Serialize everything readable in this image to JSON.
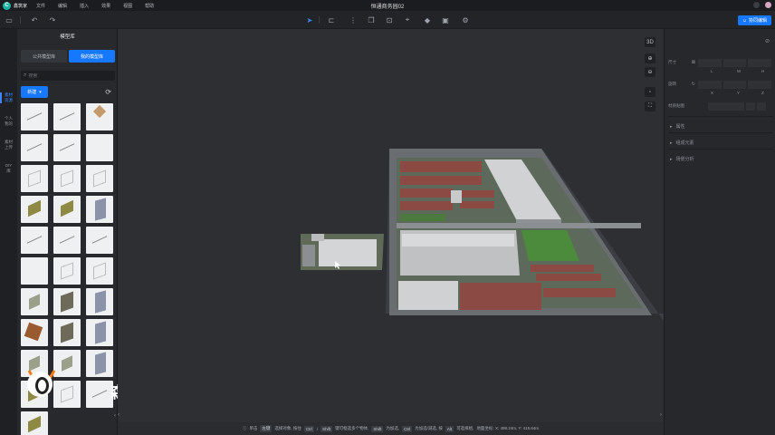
{
  "app": {
    "brand": "鑫筑家",
    "project_title": "恒通商务园02",
    "menus": [
      "文件",
      "编辑",
      "插入",
      "效果",
      "视图",
      "帮助"
    ]
  },
  "toolbar": {
    "collab_label": "协同编辑"
  },
  "rail": {
    "items": [
      "素材\n资源",
      "个人\n我的",
      "素材\n上传",
      "DIY\n库"
    ]
  },
  "library": {
    "title": "模型库",
    "tabs": [
      "公共模型库",
      "我的模型库"
    ],
    "active_tab": 1,
    "search_placeholder": "搜索",
    "filter_label": "新建"
  },
  "watermark": {
    "text": "森园"
  },
  "props": {
    "size_label": "尺寸",
    "rotate_label": "旋转",
    "material_label": "材质贴图",
    "axes_size": [
      "L",
      "W",
      "H"
    ],
    "axes_rot": [
      "X",
      "Y",
      "Z"
    ],
    "sections": [
      "属性",
      "组成元素",
      "场景分析"
    ]
  },
  "statusbar": {
    "items": [
      {
        "type": "text",
        "value": "单击"
      },
      {
        "type": "kbd",
        "value": "左键"
      },
      {
        "type": "text",
        "value": "选择对象, 按住"
      },
      {
        "type": "kbd",
        "value": "Ctrl"
      },
      {
        "type": "text",
        "value": "/"
      },
      {
        "type": "kbd",
        "value": "Shift"
      },
      {
        "type": "text",
        "value": "键可框选多个物体,"
      },
      {
        "type": "kbd",
        "value": "Shift"
      },
      {
        "type": "text",
        "value": "为加选,"
      },
      {
        "type": "kbd",
        "value": "Ctrl"
      },
      {
        "type": "text",
        "value": "为加选/减选, 按"
      },
      {
        "type": "kbd",
        "value": "Alt"
      },
      {
        "type": "text",
        "value": "可选择组,"
      },
      {
        "type": "text",
        "value": "地面坐标: X: 498.24m, Y: 415.64m"
      }
    ]
  },
  "viewport": {
    "view_mode": "3D"
  }
}
